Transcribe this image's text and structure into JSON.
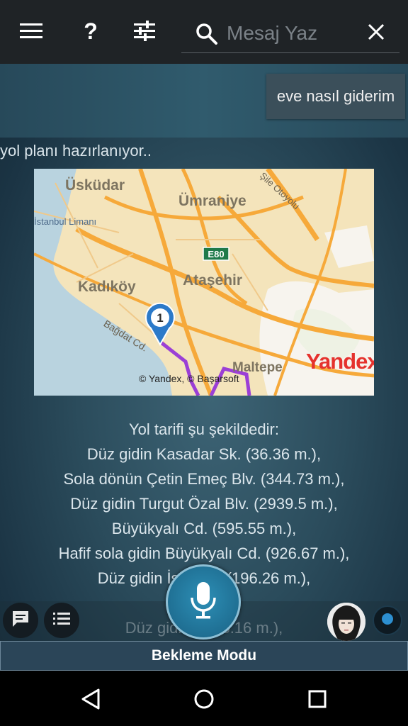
{
  "header": {
    "search_placeholder": "Mesaj Yaz"
  },
  "chat": {
    "user_message": "eve nasıl giderim",
    "status": "yol planı hazırlanıyor..",
    "directions": [
      "Yol tarifi şu şekildedir:",
      "Düz gidin Kasadar Sk. (36.36 m.),",
      "Sola dönün Çetin Emeç Blv. (344.73 m.),",
      "Düz gidin Turgut Özal Blv. (2939.5 m.),",
      "Büyükyalı Cd. (595.55 m.),",
      "Hafif sola gidin Büyükyalı Cd. (926.67 m.),",
      "Düz gidin İsti",
      "(196.26 m.),",
      "Düz gidin",
      "3.16 m.),"
    ]
  },
  "map": {
    "labels": {
      "uskudar": "Üsküdar",
      "umraniye": "Ümraniye",
      "istanbul_limani": "İstanbul Limanı",
      "kadikoy": "Kadıköy",
      "atasehir": "Ataşehir",
      "maltepe": "Maltepe",
      "bagdat": "Bağdat Cd.",
      "highway": "E80",
      "otoyol": "Şile Otoyolu",
      "attribution": "© Yandex, © Başarsoft",
      "brand": "Yandex"
    },
    "marker_number": "1",
    "route_color": "#9b3fd6"
  },
  "footer": {
    "mode_label": "Bekleme Modu"
  },
  "colors": {
    "accent": "#2d8fb6",
    "topbar": "#1f2326"
  }
}
